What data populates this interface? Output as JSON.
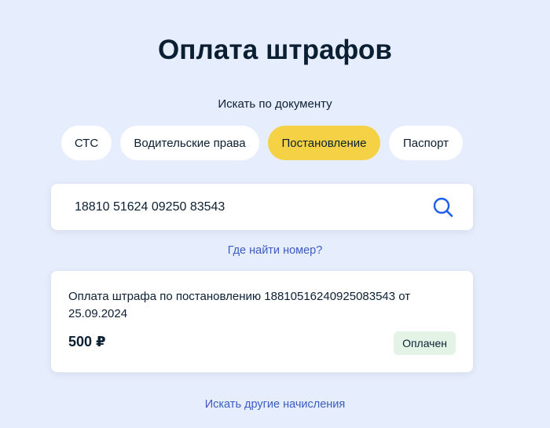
{
  "page": {
    "title": "Оплата штрафов",
    "search_by_label": "Искать по документу"
  },
  "doc_tabs": [
    {
      "label": "СТС",
      "active": false
    },
    {
      "label": "Водительские права",
      "active": false
    },
    {
      "label": "Постановление",
      "active": true
    },
    {
      "label": "Паспорт",
      "active": false
    }
  ],
  "search": {
    "value": "18810 51624 09250 83543",
    "icon": "search-icon"
  },
  "help_link": "Где найти номер?",
  "result": {
    "description": "Оплата штрафа по постановлению 18810516240925083543 от 25.09.2024",
    "amount": "500 ₽",
    "status": "Оплачен"
  },
  "other_link": "Искать другие начисления",
  "colors": {
    "background": "#e6edfc",
    "active_tab": "#f5d245",
    "link": "#3b5cc4",
    "status_bg": "#e3f4e7",
    "search_icon": "#1d5deb"
  }
}
